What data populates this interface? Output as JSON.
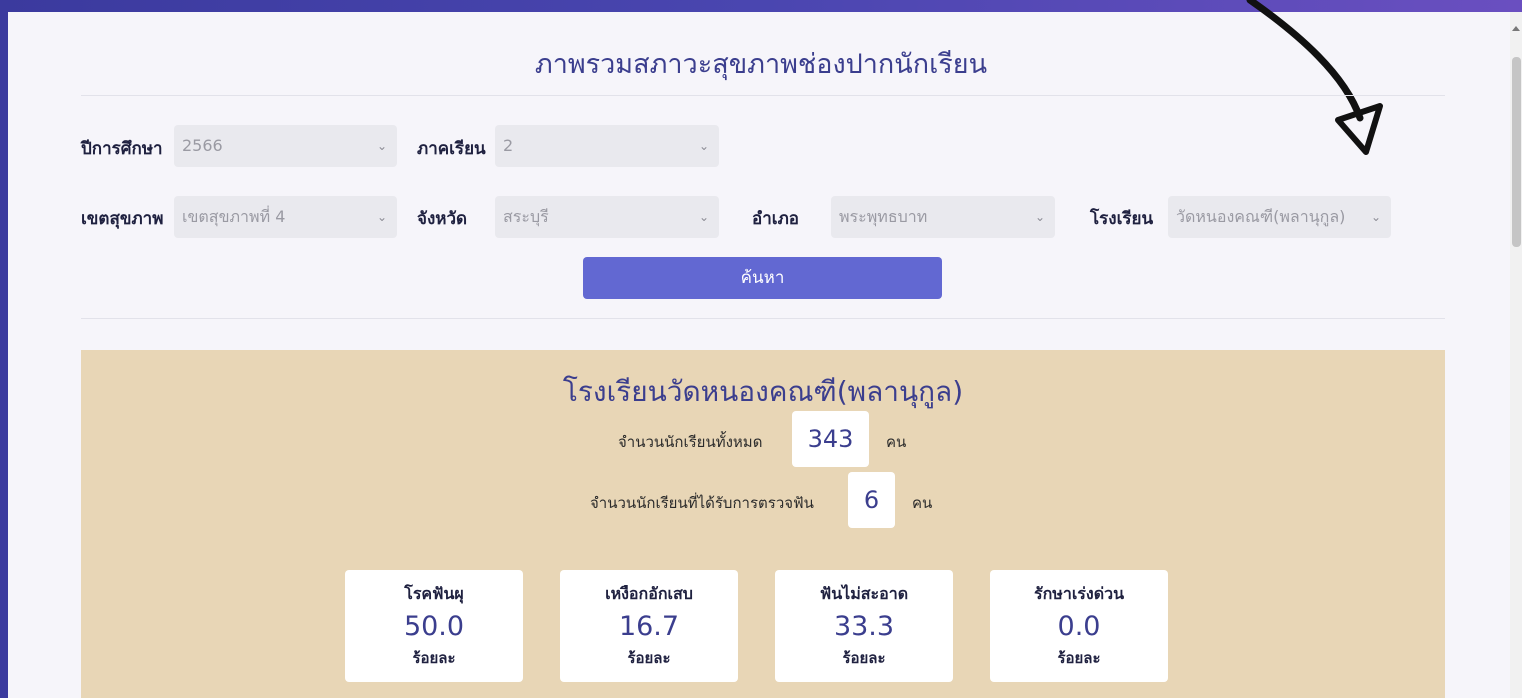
{
  "page": {
    "title": "ภาพรวมสภาวะสุขภาพช่องปากนักเรียน"
  },
  "filters": {
    "year": {
      "label": "ปีการศึกษา",
      "value": "2566"
    },
    "semester": {
      "label": "ภาคเรียน",
      "value": "2"
    },
    "health_zone": {
      "label": "เขตสุขภาพ",
      "value": "เขตสุขภาพที่ 4"
    },
    "province": {
      "label": "จังหวัด",
      "value": "สระบุรี"
    },
    "district": {
      "label": "อำเภอ",
      "value": "พระพุทธบาท"
    },
    "school": {
      "label": "โรงเรียน",
      "value": "วัดหนองคณฑี(พลานุกูล)"
    },
    "search_label": "ค้นหา"
  },
  "summary": {
    "school_name": "โรงเรียนวัดหนองคณฑี(พลานุกูล)",
    "total_students_label": "จำนวนนักเรียนทั้งหมด",
    "total_students": "343",
    "examined_label": "จำนวนนักเรียนที่ได้รับการตรวจฟัน",
    "examined": "6",
    "unit_person": "คน"
  },
  "cards": [
    {
      "label": "โรคฟันผุ",
      "value": "50.0",
      "unit": "ร้อยละ"
    },
    {
      "label": "เหงือกอักเสบ",
      "value": "16.7",
      "unit": "ร้อยละ"
    },
    {
      "label": "ฟันไม่สะอาด",
      "value": "33.3",
      "unit": "ร้อยละ"
    },
    {
      "label": "รักษาเร่งด่วน",
      "value": "0.0",
      "unit": "ร้อยละ"
    }
  ],
  "icons": {
    "chevron": "chevron-down-icon",
    "annotation": "hand-drawn-arrow-icon"
  }
}
